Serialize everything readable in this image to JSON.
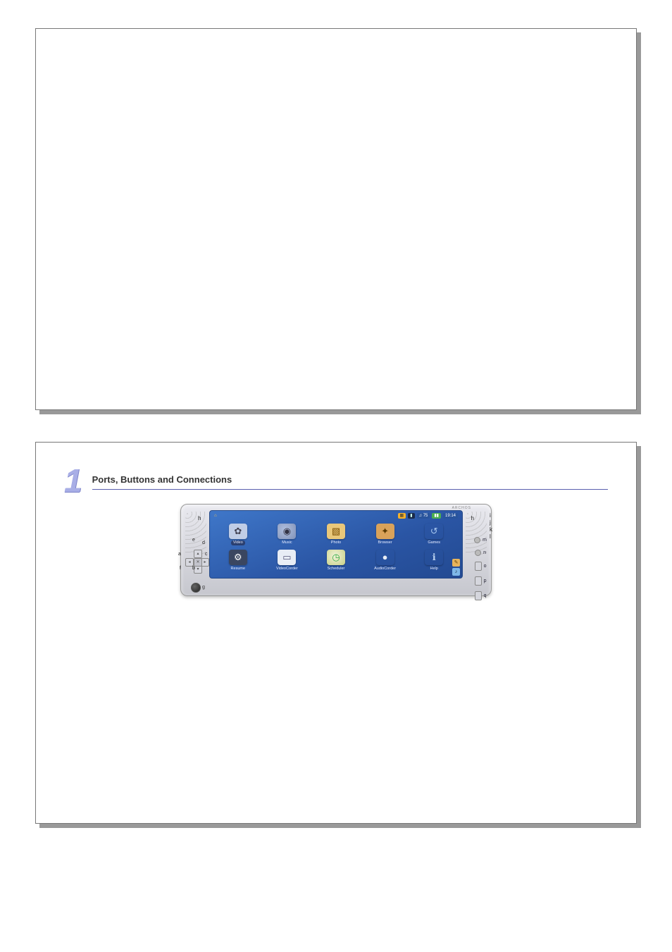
{
  "page1": {},
  "page2": {
    "chapter_number": "1",
    "chapter_title": "Ports, Buttons and Connections",
    "device": {
      "logo": "ARCHOS",
      "status": {
        "home_icon": "home-icon",
        "hp": "75",
        "time": "19:14"
      },
      "left_label": "h",
      "right_label": "h",
      "right_stack": [
        "i",
        "j",
        "k",
        "l",
        "m",
        "n",
        "o",
        "p",
        "q"
      ],
      "dpad": {
        "up": "e",
        "left": "a",
        "center": "x",
        "right": "c",
        "down": "b",
        "extra": "f",
        "corner": "d"
      },
      "ir_label": "g",
      "apps_row1": [
        {
          "name": "video",
          "label": "Video",
          "glyph": "✿",
          "cls": "ic-video",
          "selected": true
        },
        {
          "name": "music",
          "label": "Music",
          "glyph": "◉",
          "cls": "ic-music"
        },
        {
          "name": "photo",
          "label": "Photo",
          "glyph": "▧",
          "cls": "ic-photo"
        },
        {
          "name": "browser",
          "label": "Browser",
          "glyph": "✦",
          "cls": "ic-browser"
        },
        {
          "name": "games",
          "label": "Games",
          "glyph": "↺",
          "cls": "ic-games"
        }
      ],
      "apps_row2": [
        {
          "name": "resume",
          "label": "Resume",
          "glyph": "⚙",
          "cls": "ic-resume"
        },
        {
          "name": "videocorder",
          "label": "VideoCorder",
          "glyph": "▭",
          "cls": "ic-vcord"
        },
        {
          "name": "scheduler",
          "label": "Scheduler",
          "glyph": "◷",
          "cls": "ic-sched"
        },
        {
          "name": "audiocorder",
          "label": "AudioCorder",
          "glyph": "●",
          "cls": "ic-acord"
        },
        {
          "name": "help",
          "label": "Help",
          "glyph": "ℹ",
          "cls": "ic-help"
        }
      ]
    }
  }
}
